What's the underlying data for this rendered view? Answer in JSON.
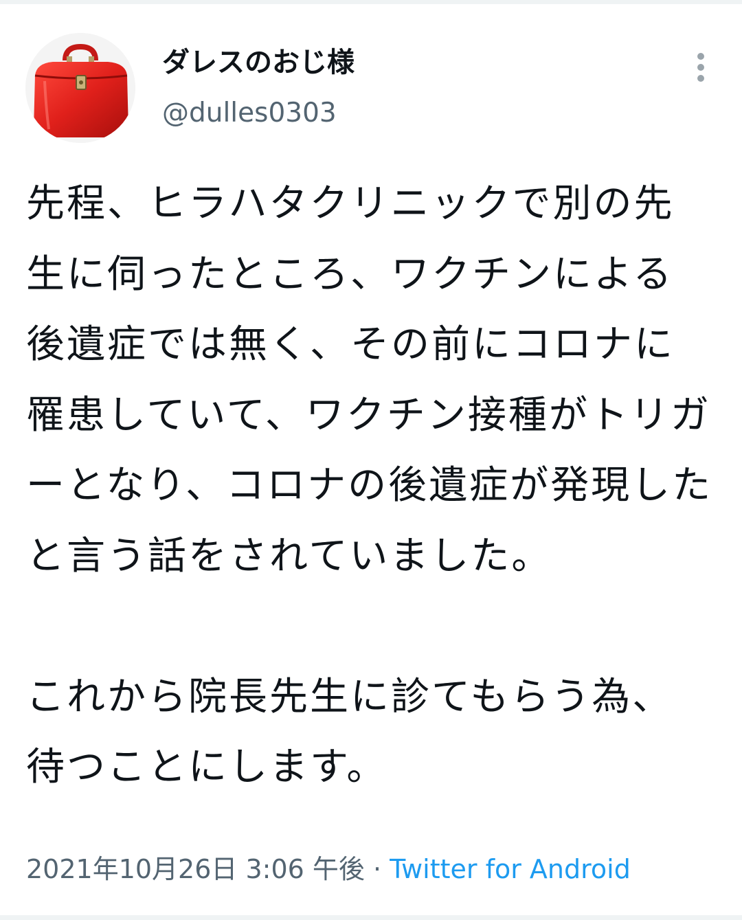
{
  "tweet": {
    "author": {
      "display_name": "ダレスのおじ様",
      "handle": "@dulles0303",
      "avatar_icon": "red-doctor-bag-icon"
    },
    "more_icon": "more-vertical-icon",
    "text": "先程、ヒラハタクリニックで別の先生に伺ったところ、ワクチンによる後遺症では無く、その前にコロナに罹患していて、ワクチン接種がトリガーとなり、コロナの後遺症が発現したと言う話をされていました。\n\nこれから院長先生に診てもらう為、待つことにします。",
    "timestamp": "2021年10月26日 3:06 午後",
    "separator": " · ",
    "source": "Twitter for Android"
  },
  "colors": {
    "text": "#0f1419",
    "secondary": "#536471",
    "link": "#1d9bf0",
    "avatar_bag": "#e0201b"
  }
}
